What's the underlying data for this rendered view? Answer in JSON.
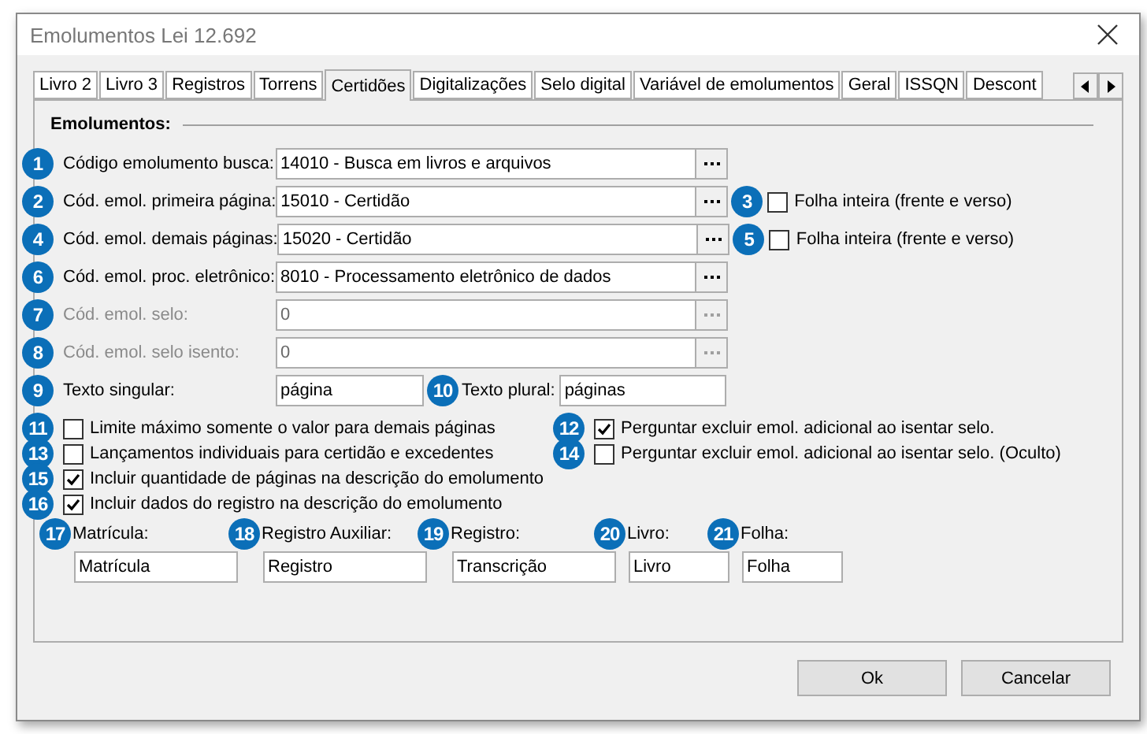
{
  "window": {
    "title": "Emolumentos Lei 12.692"
  },
  "tabs": [
    {
      "label": "Livro 2",
      "selected": false
    },
    {
      "label": "Livro 3",
      "selected": false
    },
    {
      "label": "Registros",
      "selected": false
    },
    {
      "label": "Torrens",
      "selected": false
    },
    {
      "label": "Certidões",
      "selected": true
    },
    {
      "label": "Digitalizações",
      "selected": false
    },
    {
      "label": "Selo digital",
      "selected": false
    },
    {
      "label": "Variável de emolumentos",
      "selected": false
    },
    {
      "label": "Geral",
      "selected": false
    },
    {
      "label": "ISSQN",
      "selected": false
    },
    {
      "label": "Descont",
      "selected": false
    }
  ],
  "section_title": "Emolumentos:",
  "code_fields": [
    {
      "badge": "1",
      "label": "Código emolumento busca:",
      "value": "14010 - Busca em livros e arquivos",
      "disabled": false
    },
    {
      "badge": "2",
      "label": "Cód. emol. primeira página:",
      "value": "15010 - Certidão",
      "disabled": false,
      "side_checkbox": {
        "badge": "3",
        "label": "Folha inteira (frente e verso)",
        "checked": false
      }
    },
    {
      "badge": "4",
      "label": "Cód. emol. demais páginas:",
      "value": "15020 - Certidão",
      "disabled": false,
      "side_checkbox": {
        "badge": "5",
        "label": "Folha inteira (frente e verso)",
        "checked": false
      }
    },
    {
      "badge": "6",
      "label": "Cód. emol. proc. eletrônico:",
      "value": "8010 - Processamento eletrônico de dados",
      "disabled": false
    },
    {
      "badge": "7",
      "label": "Cód. emol. selo:",
      "value": "0",
      "disabled": true
    },
    {
      "badge": "8",
      "label": "Cód. emol. selo isento:",
      "value": "0",
      "disabled": true
    }
  ],
  "text_fields": [
    {
      "badge": "9",
      "label": "Texto singular:",
      "value": "página"
    },
    {
      "badge": "10",
      "label": "Texto plural:",
      "value": "páginas"
    }
  ],
  "checkbox_rows": [
    [
      {
        "badge": "11",
        "label": "Limite máximo somente o valor para demais páginas",
        "checked": false
      },
      {
        "badge": "12",
        "label": "Perguntar excluir emol. adicional ao isentar selo.",
        "checked": true
      }
    ],
    [
      {
        "badge": "13",
        "label": "Lançamentos individuais para certidão e excedentes",
        "checked": false
      },
      {
        "badge": "14",
        "label": "Perguntar excluir emol. adicional ao isentar selo. (Oculto)",
        "checked": false
      }
    ],
    [
      {
        "badge": "15",
        "label": "Incluir quantidade de páginas na descrição do emolumento",
        "checked": true
      }
    ],
    [
      {
        "badge": "16",
        "label": "Incluir dados do registro na descrição do emolumento",
        "checked": true
      }
    ]
  ],
  "register_fields": [
    {
      "badge": "17",
      "label": "Matrícula:",
      "value": "Matrícula"
    },
    {
      "badge": "18",
      "label": "Registro Auxiliar:",
      "value": "Registro"
    },
    {
      "badge": "19",
      "label": "Registro:",
      "value": "Transcrição"
    },
    {
      "badge": "20",
      "label": "Livro:",
      "value": "Livro"
    },
    {
      "badge": "21",
      "label": "Folha:",
      "value": "Folha"
    }
  ],
  "buttons": [
    "Ok",
    "Cancelar"
  ]
}
